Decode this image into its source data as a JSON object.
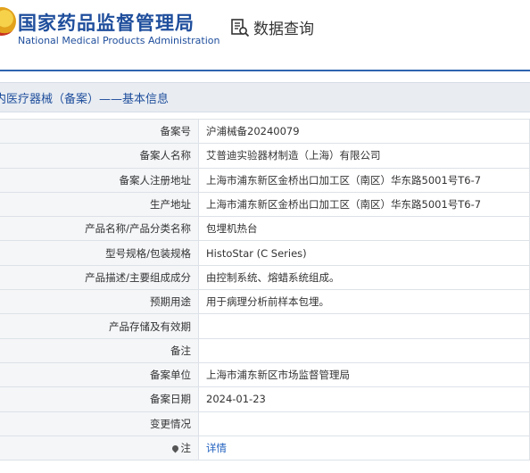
{
  "header": {
    "site_name_cn": "国家药品监督管理局",
    "site_name_en": "National Medical Products Administration",
    "query_label": "数据查询",
    "query_icon": "search-document-icon"
  },
  "section": {
    "title": "内医疗器械（备案）——基本信息"
  },
  "rows": [
    {
      "label": "备案号",
      "value": "沪浦械备20240079"
    },
    {
      "label": "备案人名称",
      "value": "艾普迪实验器材制造（上海）有限公司"
    },
    {
      "label": "备案人注册地址",
      "value": "上海市浦东新区金桥出口加工区（南区）华东路5001号T6-7"
    },
    {
      "label": "生产地址",
      "value": "上海市浦东新区金桥出口加工区（南区）华东路5001号T6-7"
    },
    {
      "label": "产品名称/产品分类名称",
      "value": "包埋机热台"
    },
    {
      "label": "型号规格/包装规格",
      "value": "HistoStar (C Series)"
    },
    {
      "label": "产品描述/主要组成成分",
      "value": "由控制系统、熔蜡系统组成。"
    },
    {
      "label": "预期用途",
      "value": "用于病理分析前样本包埋。"
    },
    {
      "label": "产品存储及有效期",
      "value": ""
    },
    {
      "label": "备注",
      "value": ""
    },
    {
      "label": "备案单位",
      "value": "上海市浦东新区市场监督管理局"
    },
    {
      "label": "备案日期",
      "value": "2024-01-23"
    },
    {
      "label": "变更情况",
      "value": ""
    }
  ],
  "note_row": {
    "label": "注",
    "link_text": "详情",
    "icon": "pin-icon"
  },
  "colors": {
    "brand_blue": "#1f4e9c",
    "link_blue": "#1f5fbf",
    "label_bg": "#f4f6f8",
    "titlebar_bg": "#e9edf2"
  }
}
